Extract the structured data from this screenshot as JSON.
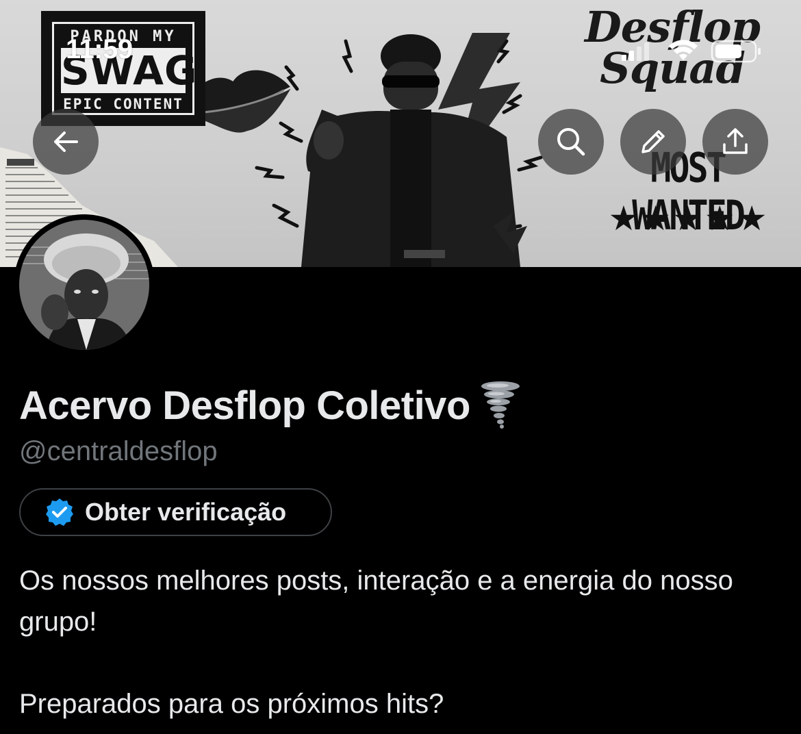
{
  "status_bar": {
    "time": "11:59"
  },
  "banner": {
    "logo_top": "PARDON MY",
    "logo_mid": "SWAG",
    "logo_bottom": "EPIC CONTENT",
    "script_title": "Desflop Squad",
    "wanted_text": "MOST WANTED",
    "stars": "★★★★★"
  },
  "toolbar": {
    "back_icon": "arrow-left-icon",
    "search_icon": "search-icon",
    "edit_icon": "pencil-icon",
    "share_icon": "share-icon"
  },
  "profile": {
    "display_name": "Acervo Desflop Coletivo",
    "name_emoji": "tornado-icon",
    "handle": "@centraldesflop",
    "verify_label": "Obter verificação",
    "verify_color": "#1d9bf0",
    "bio_line1": "Os nossos melhores posts, interação e a energia do nosso grupo!",
    "bio_line2": "Preparados para os próximos hits?"
  },
  "colors": {
    "background": "#000000",
    "text_primary": "#e7e9ea",
    "text_secondary": "#71767b",
    "button_border": "#3e4144"
  }
}
